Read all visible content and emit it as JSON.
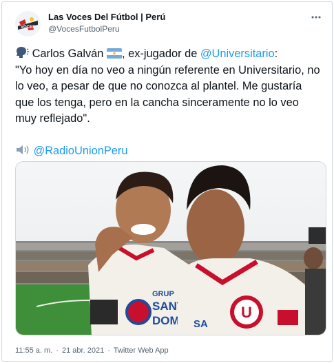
{
  "account": {
    "name": "Las Voces Del Fútbol | Perú",
    "handle": "@VocesFutbolPeru",
    "avatar_text": "VOCES"
  },
  "menu_icon": "more-horizontal-icon",
  "tweet": {
    "player": "Carlos Galván",
    "mid": ", ex-jugador de ",
    "club_mention": "@Universitario",
    "colon": ":",
    "quote": "\"Yo hoy en día no veo a ningún referente en Universitario, no lo veo, a pesar de que no conozca al plantel. Me gustaría que los tenga, pero en la cancha sinceramente no lo veo muy reflejado\".",
    "radio_mention": "@RadioUnionPeru"
  },
  "media": {
    "jersey_sponsor": [
      "GRUP",
      "SANT",
      "DOM"
    ],
    "badge_letter": "U",
    "jersey_logo_text": "SA"
  },
  "footer": {
    "time": "11:55 a. m.",
    "sep": "·",
    "date": "21 abr. 2021",
    "sep2": "·",
    "app": "Twitter Web App"
  }
}
